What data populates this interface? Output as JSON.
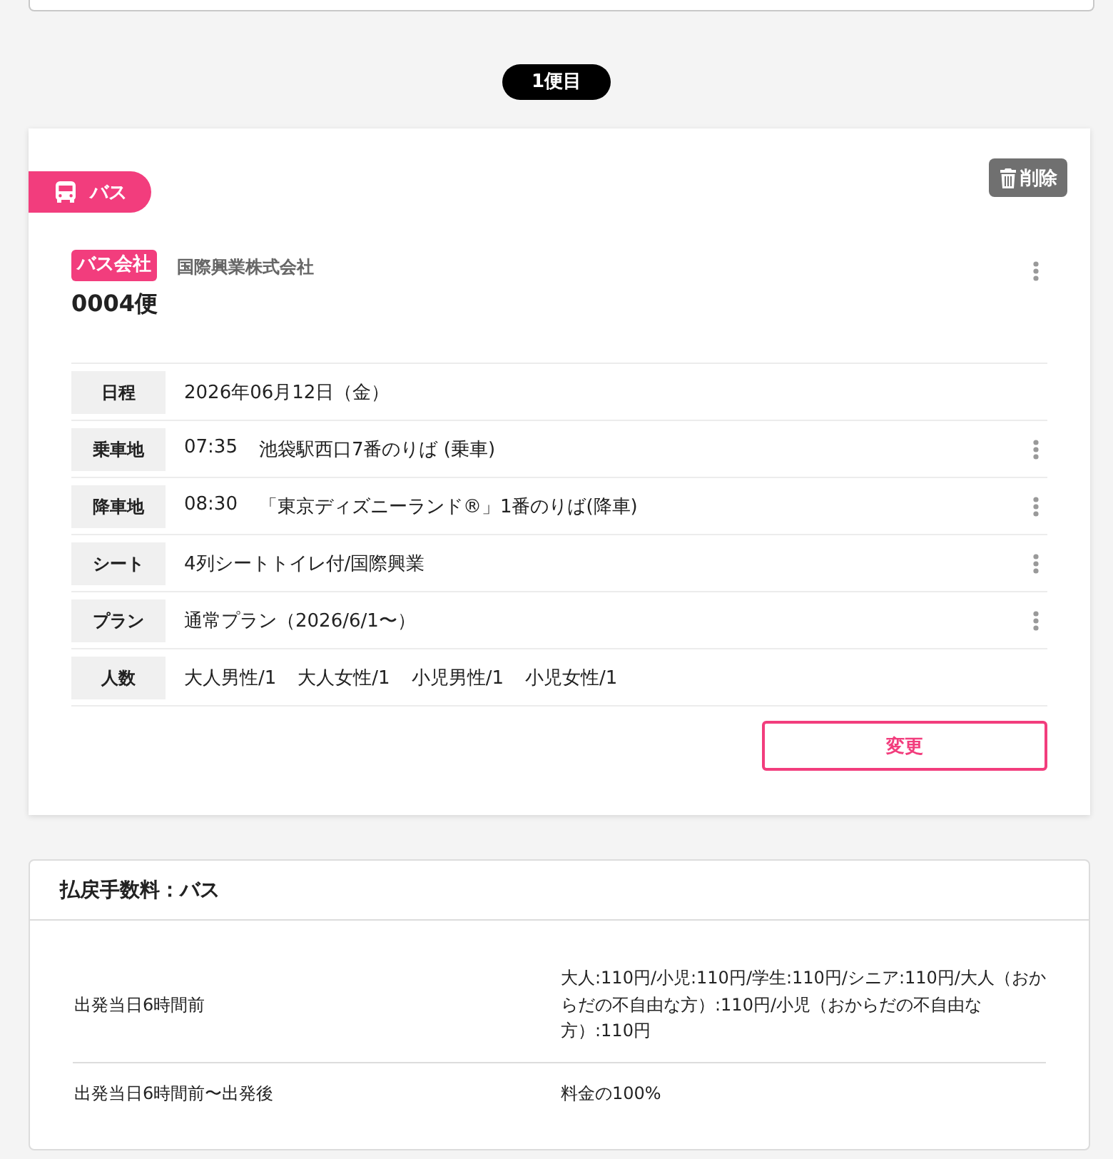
{
  "flight_label": "1便目",
  "segment": {
    "mode": {
      "kind": "bus",
      "label": "バス"
    },
    "delete_button": "削除",
    "company_tag": "バス会社",
    "company_name": "国際興業株式会社",
    "company_menu": true,
    "service_number": "0004便",
    "details": [
      {
        "label": "日程",
        "parts": [
          "2026年06月12日（金）"
        ],
        "menu": false
      },
      {
        "label": "乗車地",
        "parts": [
          "07:35",
          "池袋駅西口7番のりば (乗車)"
        ],
        "menu": true
      },
      {
        "label": "降車地",
        "parts": [
          "08:30",
          "「東京ディズニーランド®」1番のりば(降車)"
        ],
        "menu": true
      },
      {
        "label": "シート",
        "parts": [
          "4列シートトイレ付/国際興業"
        ],
        "menu": true
      },
      {
        "label": "プラン",
        "parts": [
          "通常プラン（2026/6/1〜）"
        ],
        "menu": true
      },
      {
        "label": "人数",
        "parts": [
          "大人男性/1",
          "大人女性/1",
          "小児男性/1",
          "小児女性/1"
        ],
        "menu": false
      }
    ],
    "change_button": "変更"
  },
  "refund_fees": {
    "title": "払戻手数料：バス",
    "rows": [
      {
        "timing": "出発当日6時間前",
        "fee": "大人:110円/小児:110円/学生:110円/シニア:110円/大人（おからだの不自由な方）:110円/小児（おからだの不自由な方）:110円"
      },
      {
        "timing": "出発当日6時間前〜出発後",
        "fee": "料金の100%"
      }
    ]
  }
}
